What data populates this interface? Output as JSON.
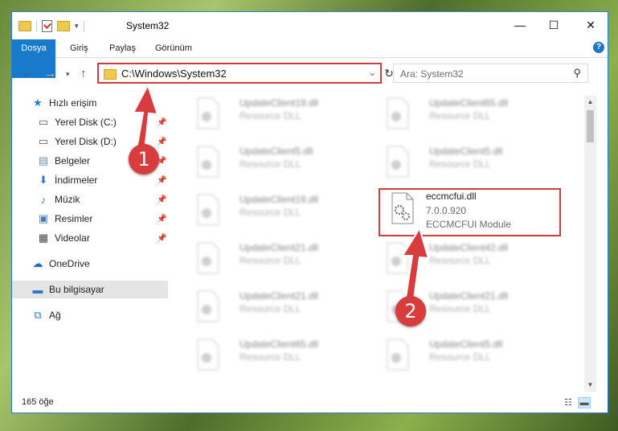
{
  "window": {
    "title": "System32",
    "controls": {
      "minimize": "—",
      "maximize": "☐",
      "close": "✕"
    }
  },
  "ribbon": {
    "tabs": [
      {
        "label": "Dosya"
      },
      {
        "label": "Giriş"
      },
      {
        "label": "Paylaş"
      },
      {
        "label": "Görünüm"
      }
    ],
    "help": "?"
  },
  "address": {
    "path": "C:\\Windows\\System32"
  },
  "search": {
    "placeholder": "Ara: System32"
  },
  "sidebar": {
    "items": [
      {
        "label": "Hızlı erişim",
        "icon": "star-icon"
      },
      {
        "label": "Yerel Disk (C:)",
        "icon": "drive-icon",
        "pinned": true
      },
      {
        "label": "Yerel Disk (D:)",
        "icon": "drive-icon",
        "pinned": true
      },
      {
        "label": "Belgeler",
        "icon": "documents-icon",
        "pinned": true
      },
      {
        "label": "İndirmeler",
        "icon": "download-icon",
        "pinned": true
      },
      {
        "label": "Müzik",
        "icon": "music-icon",
        "pinned": true
      },
      {
        "label": "Resimler",
        "icon": "pictures-icon",
        "pinned": true
      },
      {
        "label": "Videolar",
        "icon": "video-icon",
        "pinned": true
      },
      {
        "label": "OneDrive",
        "icon": "cloud-icon"
      },
      {
        "label": "Bu bilgisayar",
        "icon": "computer-icon",
        "selected": true
      },
      {
        "label": "Ağ",
        "icon": "network-icon"
      }
    ]
  },
  "files": {
    "col1": [
      {
        "name": "UpdateClient19.dll",
        "type": "Resource DLL"
      },
      {
        "name": "UpdateClient5.dll",
        "type": "Resource DLL"
      },
      {
        "name": "UpdateClient19.dll",
        "type": "Resource DLL"
      },
      {
        "name": "UpdateClient21.dll",
        "type": "Resource DLL"
      },
      {
        "name": "UpdateClient21.dll",
        "type": "Resource DLL"
      },
      {
        "name": "UpdateClient65.dll",
        "type": "Resource DLL"
      }
    ],
    "col2": [
      {
        "name": "UpdateClient65.dll",
        "type": "Resource DLL"
      },
      {
        "name": "UpdateClient5.dll",
        "type": "Resource DLL"
      },
      {
        "name": "eccmcfui.dll",
        "version": "7.0.0.920",
        "type": "ECCMCFUI Module",
        "highlighted": true
      },
      {
        "name": "UpdateClient42.dll",
        "type": "Resource DLL"
      },
      {
        "name": "UpdateClient21.dll",
        "type": "Resource DLL"
      },
      {
        "name": "UpdateClient5.dll",
        "type": "Resource DLL"
      }
    ]
  },
  "status": {
    "count": "165 öğe"
  },
  "annotations": {
    "step1": "1",
    "step2": "2",
    "color": "#d93c3c"
  }
}
